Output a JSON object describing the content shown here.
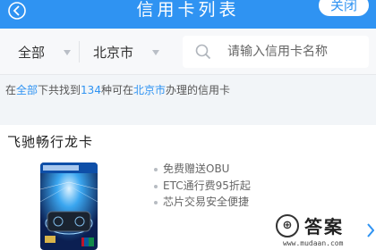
{
  "header": {
    "title": "信用卡列表",
    "close_label": "关闭"
  },
  "filters": {
    "category": "全部",
    "city": "北京市",
    "search_placeholder": "请输入信用卡名称"
  },
  "summary": {
    "prefix": "在",
    "category": "全部",
    "mid1": "下共找到",
    "count": "134",
    "mid2": "种可在",
    "city": "北京市",
    "suffix": "办理的信用卡"
  },
  "cards": [
    {
      "name": "飞驰畅行龙卡",
      "benefits": [
        "免费赠送OBU",
        "ETC通行费95折起",
        "芯片交易安全便捷"
      ]
    }
  ],
  "watermark": {
    "text": "答案",
    "url": "www.mudaan.com"
  }
}
